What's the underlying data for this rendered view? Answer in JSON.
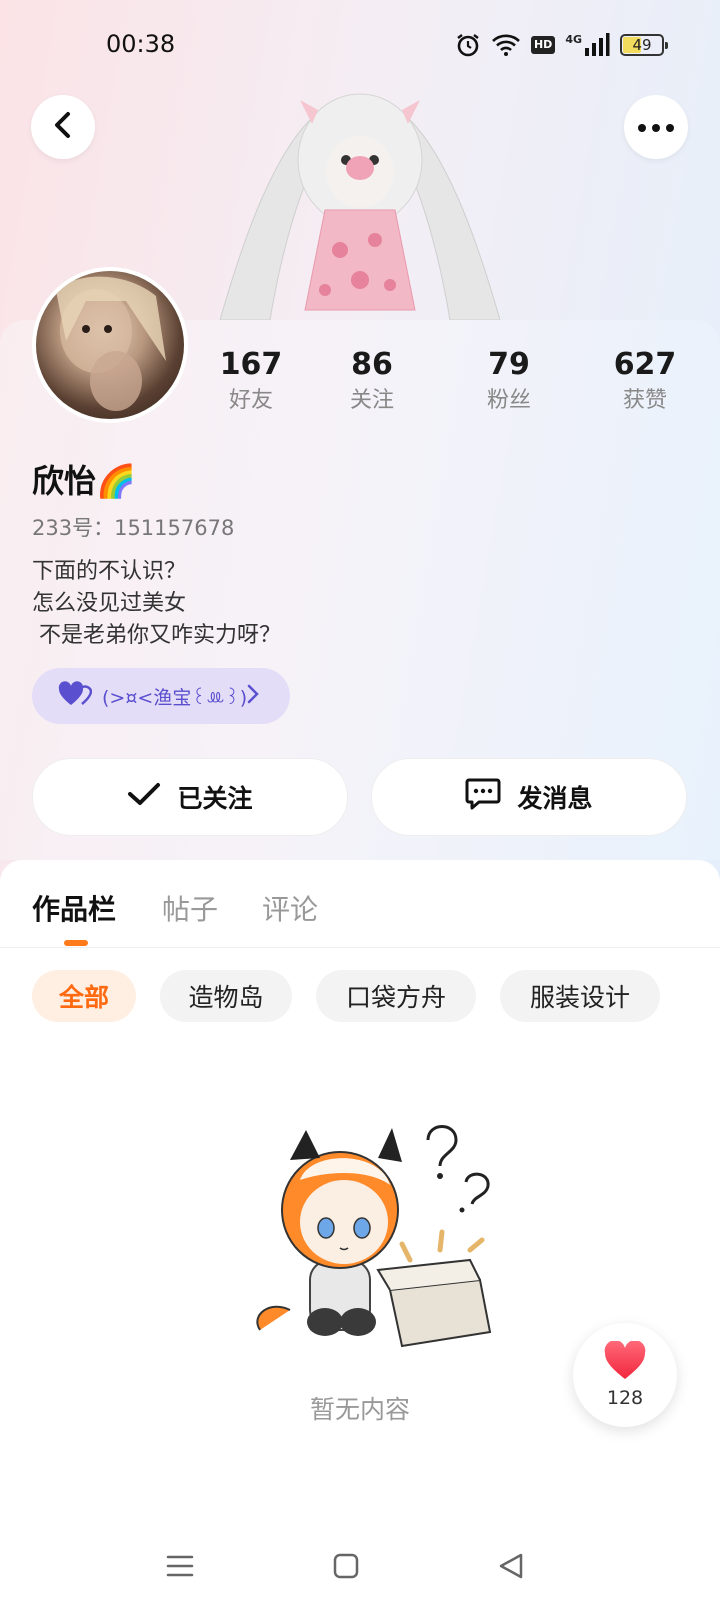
{
  "status_bar": {
    "time": "00:38",
    "hd_label": "HD",
    "network_label": "4G",
    "battery": "49",
    "battery_level": 0.49
  },
  "header": {
    "back_icon": "chevron-left-icon",
    "more_icon": "more-dots-icon"
  },
  "profile": {
    "username": "欣怡🌈",
    "user_id": "233号：151157678",
    "bio": "下面的不认识？\n怎么没见过美女\n 不是老弟你又咋实力呀？",
    "guild_label": "(>¤<渔宝꒰ꔛ꒱)"
  },
  "stats": [
    {
      "value": "167",
      "label": "好友"
    },
    {
      "value": "86",
      "label": "关注"
    },
    {
      "value": "79",
      "label": "粉丝"
    },
    {
      "value": "627",
      "label": "获赞"
    }
  ],
  "actions": {
    "follow_label": "已关注",
    "message_label": "发消息"
  },
  "tabs": [
    {
      "label": "作品栏",
      "active": true
    },
    {
      "label": "帖子",
      "active": false
    },
    {
      "label": "评论",
      "active": false
    }
  ],
  "filter_chips": [
    {
      "label": "全部",
      "active": true
    },
    {
      "label": "造物岛",
      "active": false
    },
    {
      "label": "口袋方舟",
      "active": false
    },
    {
      "label": "服装设计",
      "active": false
    }
  ],
  "empty_state": {
    "text": "暂无内容"
  },
  "like_fab": {
    "count": "128"
  },
  "colors": {
    "accent": "#ff7a1a",
    "guild_bg": "#e4ddf8",
    "guild_text": "#5a4fcf",
    "like_red": "#ff3b4f"
  }
}
